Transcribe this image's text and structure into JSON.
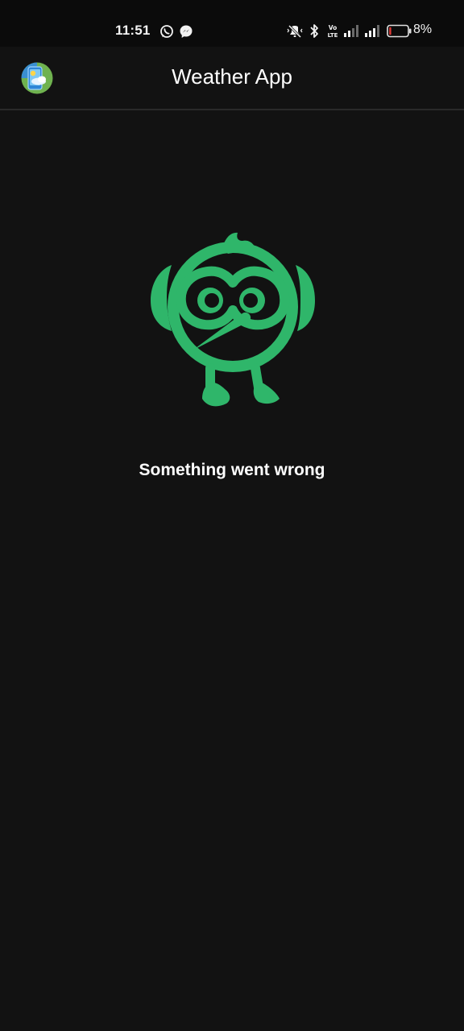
{
  "status_bar": {
    "time": "11:51",
    "notification_icons": [
      "whatsapp-icon",
      "messenger-icon"
    ],
    "system_icons": [
      "vibrate-mute-icon",
      "bluetooth-icon",
      "volte-icon",
      "signal-icon",
      "signal-icon",
      "battery-icon"
    ],
    "battery_percent": "8%",
    "battery_low_color": "#e53935"
  },
  "app_bar": {
    "title": "Weather App",
    "logo_icon": "weather-app-logo-icon"
  },
  "main": {
    "illustration_icon": "bird-mascot-icon",
    "illustration_color": "#2fb66a",
    "error_message": "Something went wrong"
  },
  "colors": {
    "background": "#121212",
    "status_bar_background": "#0b0b0b",
    "text": "#ffffff"
  }
}
